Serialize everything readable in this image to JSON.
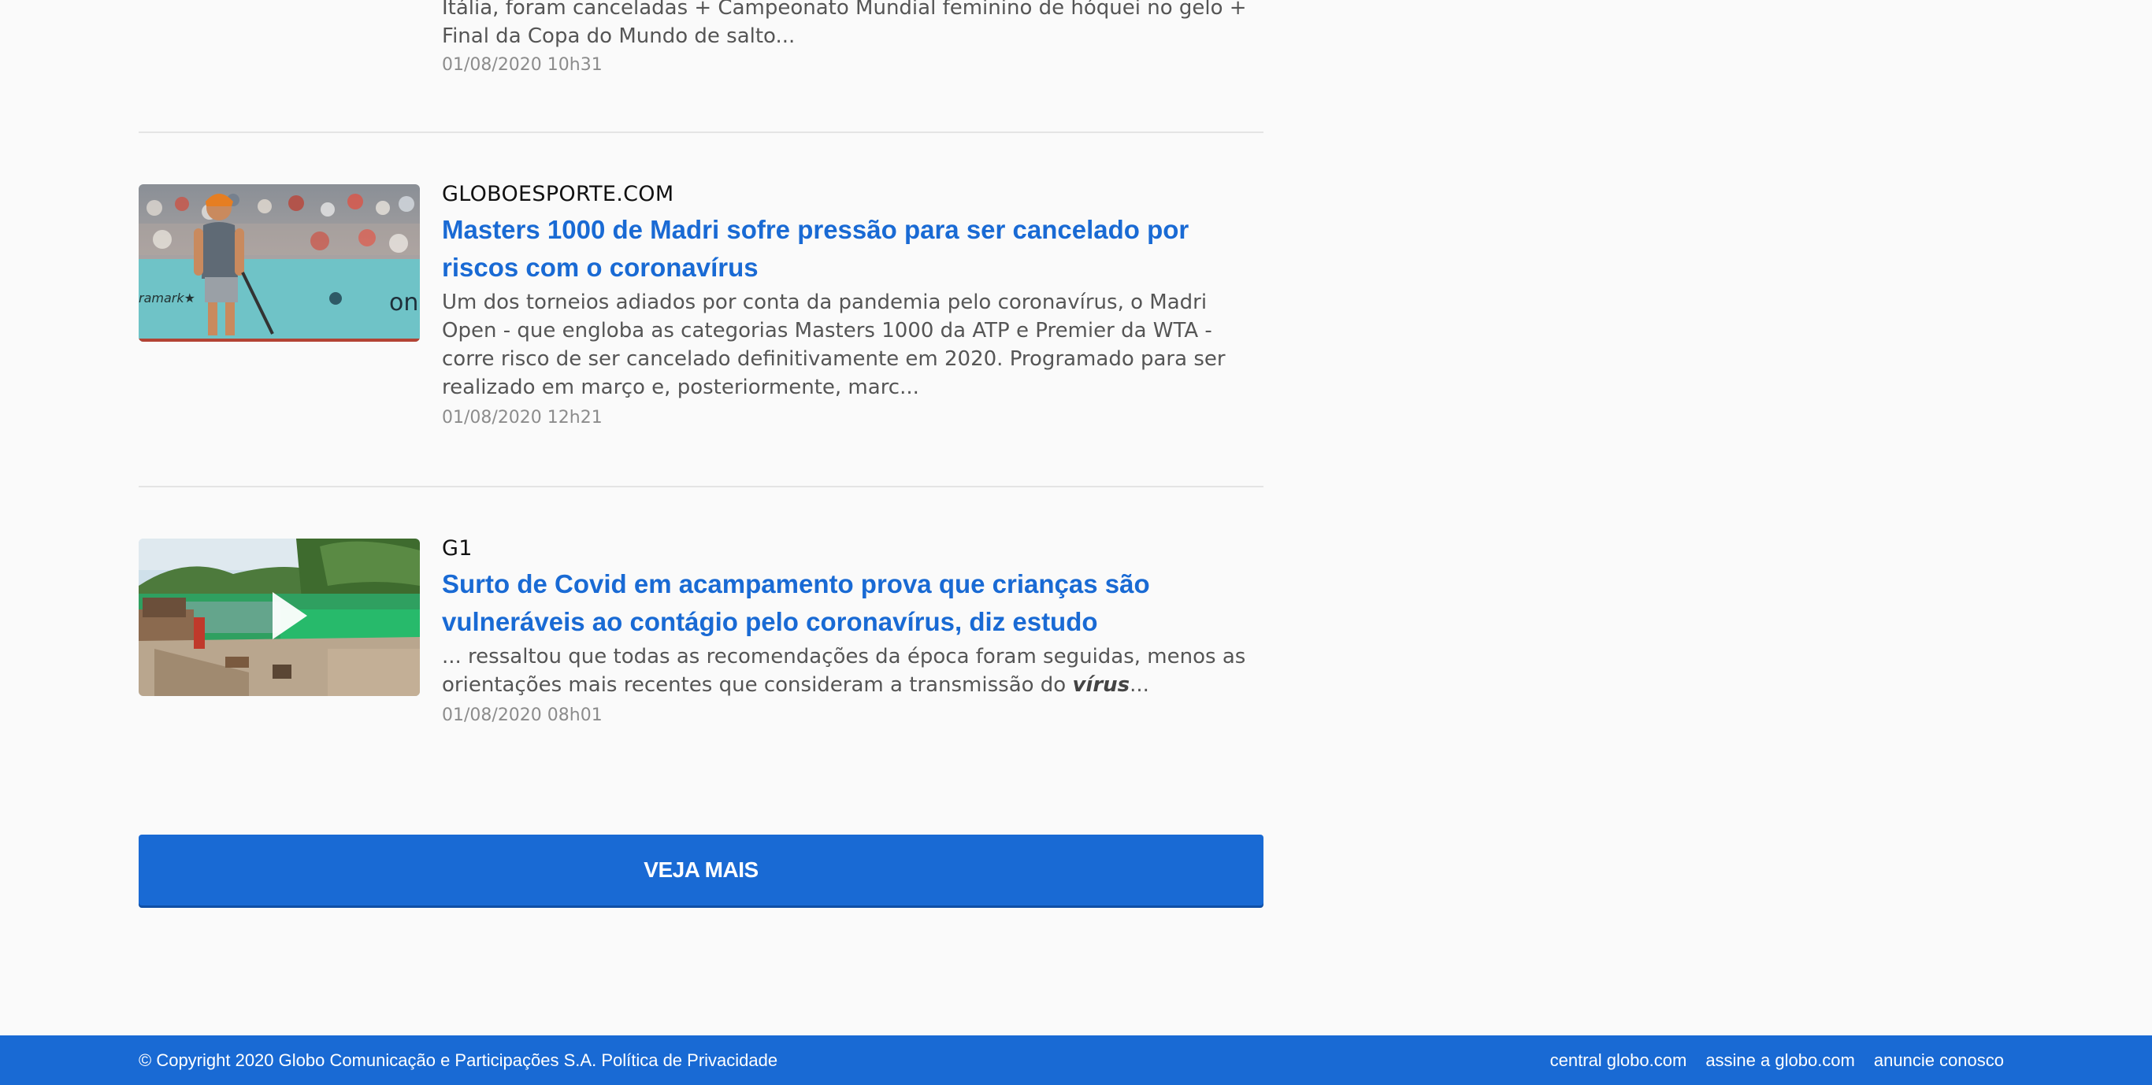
{
  "results": [
    {
      "snippet": "Itália, foram canceladas + Campeonato Mundial feminino de hóquei no gelo + Final da Copa do Mundo de salto...",
      "date": "01/08/2020 10h31"
    },
    {
      "source": "GLOBOESPORTE.COM",
      "title": "Masters 1000 de Madri sofre pressão para ser cancelado por riscos com o coronavírus",
      "snippet": "Um dos torneios adiados por conta da pandemia pelo coronavírus, o Madri Open - que engloba as categorias Masters 1000 da ATP e Premier da WTA - corre risco de ser cancelado definitivamente em 2020. Programado para ser realizado em março e, posteriormente, marc...",
      "date": "01/08/2020 12h21",
      "thumb_icon": "tennis-player-photo"
    },
    {
      "source": "G1",
      "title": "Surto de Covid em acampamento prova que crianças são vulneráveis ao contágio pelo coronavírus, diz estudo",
      "snippet_before": "... ressaltou que todas as recomendações da época foram seguidas, menos as orientações mais recentes que consideram a transmissão do ",
      "snippet_highlight": "vírus",
      "snippet_after": "...",
      "date": "01/08/2020 08h01",
      "thumb_icon": "lake-camp-video-thumbnail"
    }
  ],
  "more_button": {
    "label": "VEJA MAIS"
  },
  "footer": {
    "copyright": "© Copyright 2020 Globo Comunicação e Participações S.A.",
    "privacy": "Política de Privacidade",
    "links": [
      "central globo.com",
      "assine a globo.com",
      "anuncie conosco"
    ]
  },
  "colors": {
    "accent": "#196ad4",
    "background": "#fafafa",
    "divider": "#e4e4e4",
    "snippet": "#555555",
    "date": "#8c8c8c"
  }
}
